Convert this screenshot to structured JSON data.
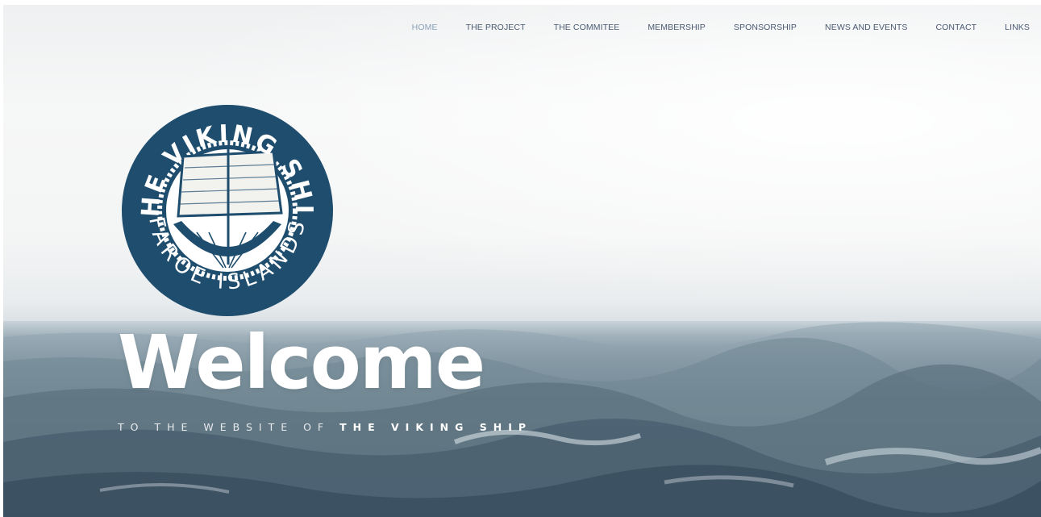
{
  "nav": {
    "items": [
      {
        "label": "HOME",
        "active": true
      },
      {
        "label": "THE PROJECT"
      },
      {
        "label": "THE COMMITEE"
      },
      {
        "label": "MEMBERSHIP"
      },
      {
        "label": "SPONSORSHIP"
      },
      {
        "label": "NEWS AND EVENTS"
      },
      {
        "label": "CONTACT"
      },
      {
        "label": "LINKS"
      }
    ]
  },
  "logo": {
    "top_text": "THE VIKING SHIP",
    "bottom_text": "FAROE ISLANDS",
    "colors": {
      "ring": "#1f4d6e",
      "inner": "#ffffff"
    }
  },
  "hero": {
    "headline": "Welcome",
    "tagline_prefix": "TO THE WEBSITE OF ",
    "tagline_strong": "THE VIKING SHIP"
  },
  "colors": {
    "nav_text": "#4a5a72",
    "nav_active": "#8aa1b8",
    "headline": "#ffffff",
    "sea_dark": "#34495a"
  }
}
